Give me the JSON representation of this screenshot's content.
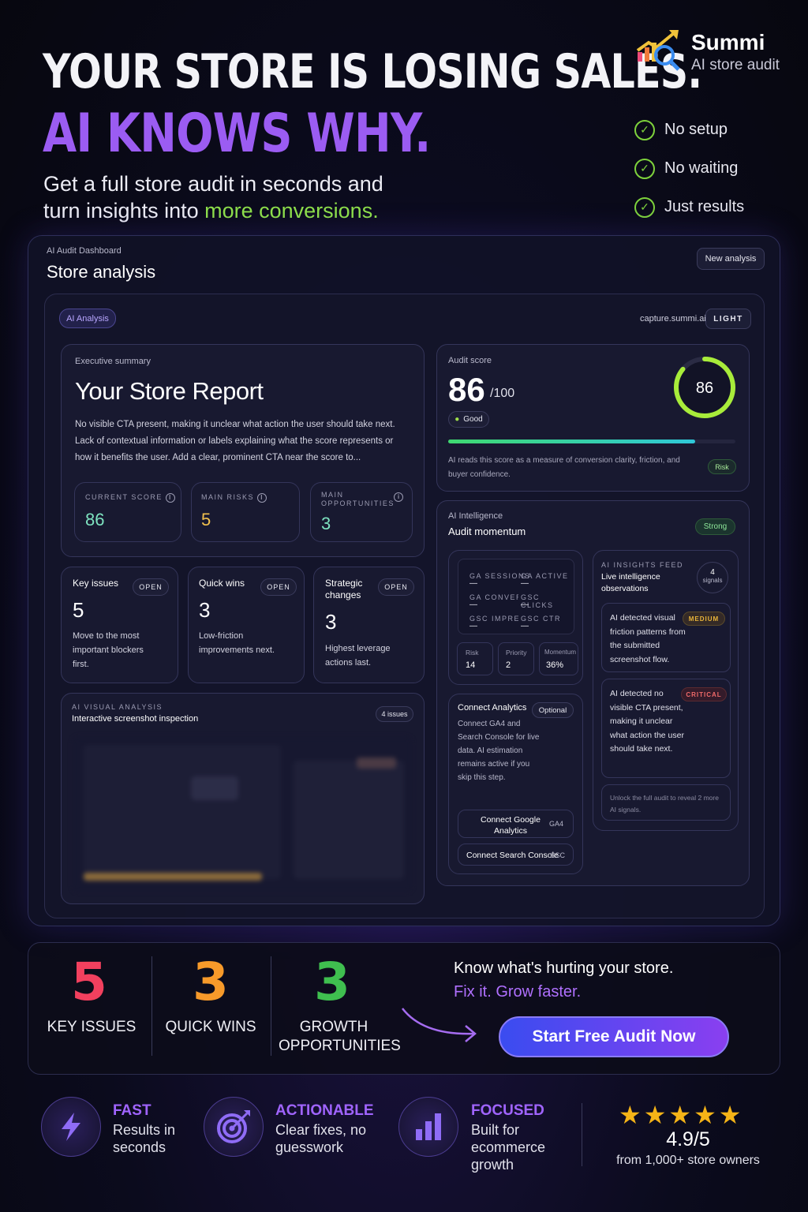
{
  "header": {
    "line1": "YOUR STORE IS LOSING SALES.",
    "line2": "AI KNOWS WHY.",
    "sub_a": "Get a full store audit in seconds and turn insights into ",
    "sub_hl": "more conversions."
  },
  "brand": {
    "name": "Summi",
    "tagline": "AI store audit"
  },
  "checks": [
    "No setup",
    "No waiting",
    "Just results"
  ],
  "dashboard": {
    "kicker": "AI Audit Dashboard",
    "title": "Store analysis",
    "new_btn": "New analysis",
    "badge": "AI Analysis",
    "domain": "capture.summi.ai",
    "light_btn": "LIGHT",
    "summary": {
      "kicker": "Executive summary",
      "title": "Your Store Report",
      "body": "No visible CTA present, making it unclear what action the user should take next. Lack of contextual information or labels explaining what the score represents or how it benefits the user. Add a clear, prominent CTA near the score to...",
      "metrics": [
        {
          "label": "CURRENT SCORE",
          "value": "86",
          "color": "#7ee3c0"
        },
        {
          "label": "MAIN RISKS",
          "value": "5",
          "color": "#f2c14e"
        },
        {
          "label": "MAIN OPPORTUNITIES",
          "value": "3",
          "color": "#7ee3c0"
        }
      ]
    },
    "issue_cards": [
      {
        "title": "Key issues",
        "btn": "OPEN",
        "value": "5",
        "desc": "Move to the most important blockers first."
      },
      {
        "title": "Quick wins",
        "btn": "OPEN",
        "value": "3",
        "desc": "Low-friction improvements next."
      },
      {
        "title": "Strategic changes",
        "btn": "OPEN",
        "value": "3",
        "desc": "Highest leverage actions last."
      }
    ],
    "visual": {
      "kicker": "AI VISUAL ANALYSIS",
      "title": "Interactive screenshot inspection",
      "count": "4 issues"
    },
    "score": {
      "kicker": "Audit score",
      "value": "86",
      "max": "/100",
      "ring_value": "86",
      "ring_fraction": 0.86,
      "bar_fraction": 0.86,
      "status": "Good",
      "note": "AI reads this score as a measure of conversion clarity, friction, and buyer confidence.",
      "risk_tag": "Risk"
    },
    "momentum": {
      "kicker": "AI Intelligence",
      "title": "Audit momentum",
      "tag": "Strong",
      "grid": [
        {
          "label": "GA SESSIONS",
          "value": "—"
        },
        {
          "label": "GA ACTIVE U...",
          "value": "—"
        },
        {
          "label": "GA CONVER...",
          "value": "—"
        },
        {
          "label": "GSC CLICKS",
          "value": "—"
        },
        {
          "label": "GSC IMPRES...",
          "value": "—"
        },
        {
          "label": "GSC CTR",
          "value": "—"
        }
      ],
      "mini": [
        {
          "label": "Risk",
          "value": "14"
        },
        {
          "label": "Priority",
          "value": "2"
        },
        {
          "label": "Momentum",
          "value": "36%"
        }
      ]
    },
    "connect": {
      "title": "Connect Analytics",
      "tag": "Optional",
      "body": "Connect GA4 and Search Console for live data. AI estimation remains active if you skip this step.",
      "btn1": "Connect Google Analytics",
      "btn1_tag": "GA4",
      "btn2": "Connect Search Console",
      "btn2_tag": "SSC"
    },
    "feed": {
      "kicker": "AI INSIGHTS FEED",
      "title": "Live intelligence observations",
      "signals_n": "4",
      "signals_l": "signals",
      "items": [
        {
          "text": "AI detected visual friction patterns from the submitted screenshot flow.",
          "tag": "MEDIUM",
          "tag_color": "#e8b43a"
        },
        {
          "text": "AI detected no visible CTA present, making it unclear what action the user should take next.",
          "tag": "CRITICAL",
          "tag_color": "#f06a6a"
        }
      ],
      "locked": "Unlock the full audit to reveal 2 more AI signals."
    }
  },
  "stats": [
    {
      "value": "5",
      "label": "KEY ISSUES",
      "color": "#f2405e"
    },
    {
      "value": "3",
      "label": "QUICK WINS",
      "color": "#f79a2a"
    },
    {
      "value": "3",
      "label": "GROWTH OPPORTUNITIES",
      "color": "#3fbf4f"
    }
  ],
  "pitch": {
    "line1": "Know what's hurting your store.",
    "line2": "Fix it. Grow faster."
  },
  "cta": "Start Free Audit Now",
  "features": [
    {
      "title": "FAST",
      "text": "Results in seconds",
      "icon": "lightning-icon"
    },
    {
      "title": "ACTIONABLE",
      "text": "Clear fixes, no guesswork",
      "icon": "target-icon"
    },
    {
      "title": "FOCUSED",
      "text": "Built for ecommerce growth",
      "icon": "bar-chart-icon"
    }
  ],
  "rating": {
    "score": "4.9/5",
    "caption": "from 1,000+ store owners",
    "stars": 5
  }
}
